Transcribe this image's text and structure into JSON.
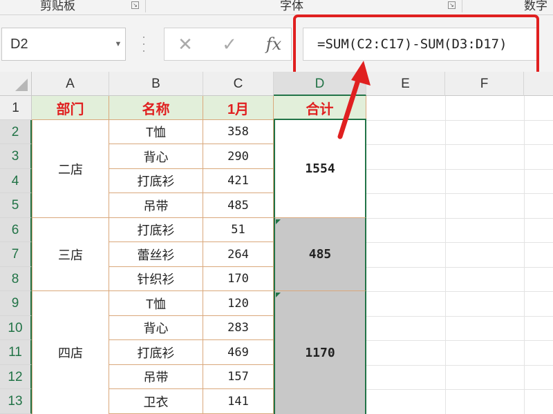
{
  "ribbon": {
    "groups": [
      "剪贴板",
      "字体",
      "数字"
    ]
  },
  "formula_bar": {
    "name_box": "D2",
    "formula": "=SUM(C2:C17)-SUM(D3:D17)",
    "fx_label": "fx",
    "cancel_icon": "✕",
    "enter_icon": "✓"
  },
  "columns": [
    "A",
    "B",
    "C",
    "D",
    "E",
    "F"
  ],
  "rows": [
    "1",
    "2",
    "3",
    "4",
    "5",
    "6",
    "7",
    "8",
    "9",
    "10",
    "11",
    "12",
    "13"
  ],
  "table": {
    "headers": {
      "dept": "部门",
      "name": "名称",
      "month": "1月",
      "total": "合计"
    },
    "stores": [
      {
        "name": "二店",
        "total": "1554",
        "items": [
          {
            "name": "T恤",
            "qty": "358"
          },
          {
            "name": "背心",
            "qty": "290"
          },
          {
            "name": "打底衫",
            "qty": "421"
          },
          {
            "name": "吊带",
            "qty": "485"
          }
        ]
      },
      {
        "name": "三店",
        "total": "485",
        "items": [
          {
            "name": "打底衫",
            "qty": "51"
          },
          {
            "name": "蕾丝衫",
            "qty": "264"
          },
          {
            "name": "针织衫",
            "qty": "170"
          }
        ]
      },
      {
        "name": "四店",
        "total": "1170",
        "items": [
          {
            "name": "T恤",
            "qty": "120"
          },
          {
            "name": "背心",
            "qty": "283"
          },
          {
            "name": "打底衫",
            "qty": "469"
          },
          {
            "name": "吊带",
            "qty": "157"
          },
          {
            "name": "卫衣",
            "qty": "141"
          }
        ]
      }
    ]
  },
  "colors": {
    "header_fill": "#e2efda",
    "header_text": "#e02020",
    "selection": "#217346",
    "annotation": "#e02020",
    "selected_cells": "#c8c8c8"
  },
  "icons": [
    "dropdown-arrow-icon",
    "cancel-icon",
    "enter-icon",
    "function-icon",
    "dialog-launcher-icon"
  ]
}
